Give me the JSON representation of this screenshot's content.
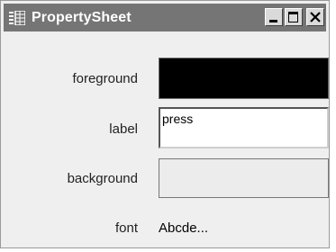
{
  "window": {
    "title": "PropertySheet",
    "icon": "property-grid-icon",
    "controls": [
      "minimize-icon",
      "maximize-icon",
      "close-icon"
    ]
  },
  "properties": {
    "foreground": {
      "label": "foreground",
      "color": "#000000"
    },
    "label": {
      "label": "label",
      "value": "press"
    },
    "background": {
      "label": "background",
      "color": "#ececec"
    },
    "font": {
      "label": "font",
      "value": "Abcde..."
    }
  },
  "colors": {
    "titlebar": "#757575",
    "window_bg": "#efefef"
  }
}
